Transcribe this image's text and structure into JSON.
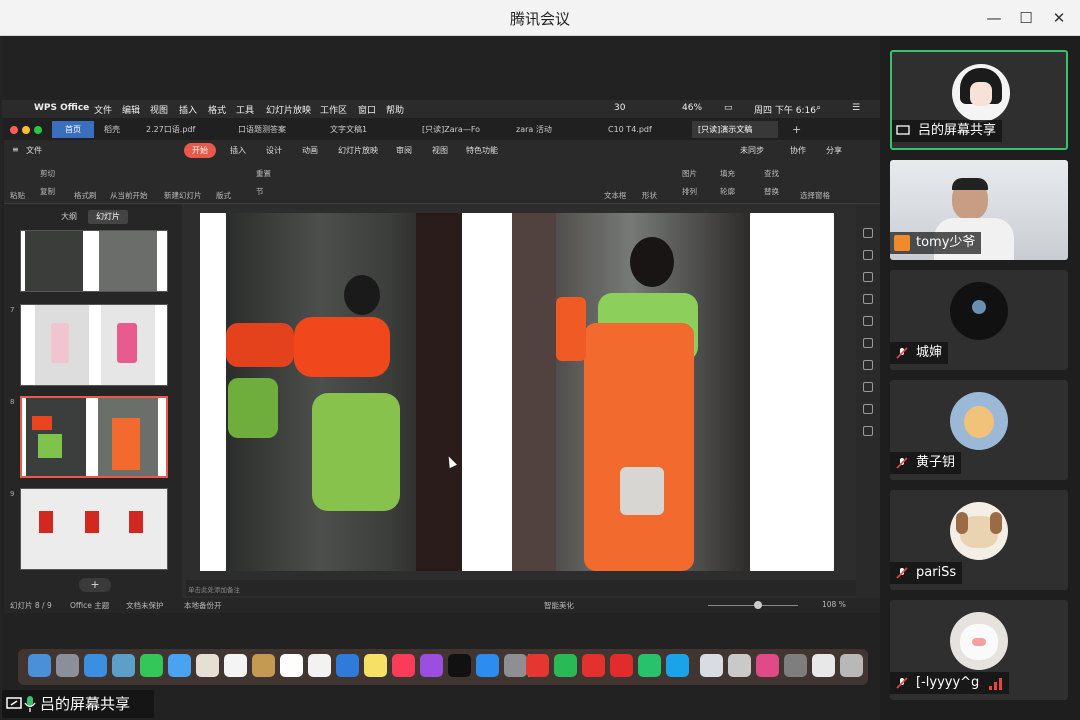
{
  "window": {
    "title": "腾讯会议"
  },
  "mac_menu": {
    "app": "WPS Office",
    "items": [
      "文件",
      "编辑",
      "视图",
      "插入",
      "格式",
      "工具",
      "幻灯片放映",
      "工作区",
      "窗口",
      "帮助"
    ],
    "battery": "46%",
    "clock": "周四 下午 6:16",
    "wechat_badge": "30"
  },
  "tabs": [
    "首页",
    "稻壳",
    "2.27口语.pdf",
    "口语题测答案",
    "文字文稿1",
    "[只读]Zara—Fo",
    "zara 活动",
    "C10 T4.pdf",
    "[只读]演示文稿"
  ],
  "wps_menu": {
    "file": "文件",
    "items": [
      "开始",
      "插入",
      "设计",
      "动画",
      "幻灯片放映",
      "审阅",
      "视图",
      "特色功能"
    ],
    "right": [
      "未同步",
      "协作",
      "分享"
    ]
  },
  "ribbon": {
    "paste": "粘贴",
    "cut": "剪切",
    "copy": "复制",
    "format_brush": "格式刷",
    "from_current": "从当前开始",
    "new_slide": "新建幻灯片",
    "layout": "版式",
    "section": "节",
    "reset": "重置",
    "textbox": "文本框",
    "shape": "形状",
    "picture": "图片",
    "arrange": "排列",
    "fill": "填充",
    "outline": "轮廓",
    "find": "查找",
    "replace": "替换",
    "select_pane": "选择窗格"
  },
  "side_panel": {
    "tab_outline": "大纲",
    "tab_slides": "幻灯片",
    "slide_numbers": [
      "7",
      "8",
      "9"
    ],
    "add": "+"
  },
  "notes_placeholder": "单击此处添加备注",
  "status": {
    "slide": "幻灯片 8 / 9",
    "theme": "Office 主题",
    "protect": "文档未保护",
    "backup": "本地备份开",
    "beautify": "智能美化",
    "zoom": "108 %"
  },
  "share_label": "吕的屏幕共享",
  "participants": [
    {
      "name": "吕的屏幕共享",
      "active": true
    },
    {
      "name": "tomy少爷",
      "active": false
    },
    {
      "name": "城婶",
      "active": false
    },
    {
      "name": "黄子钥",
      "active": false
    },
    {
      "name": "pariSs",
      "active": false
    },
    {
      "name": "[-lyyyy^g",
      "active": false
    }
  ],
  "colors": {
    "accent_green": "#3ac26a",
    "wps_orange": "#e8594a",
    "tab_blue": "#3a6fbf"
  }
}
